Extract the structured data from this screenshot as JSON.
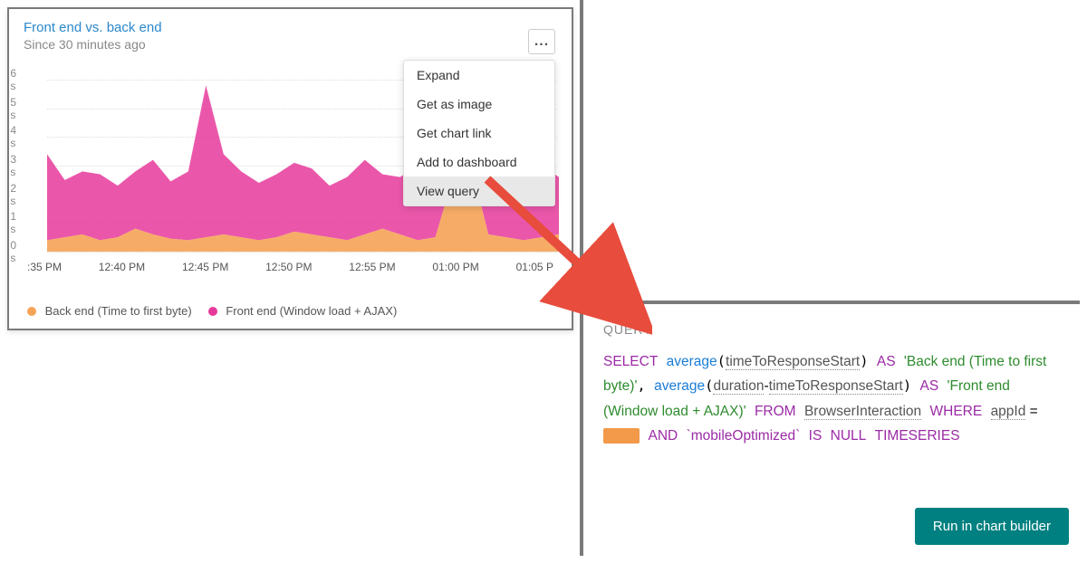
{
  "chart_data": {
    "type": "area",
    "title": "Front end vs. back end",
    "subtitle": "Since 30 minutes ago",
    "ylabel": "seconds",
    "ylim": [
      0,
      6
    ],
    "yticks": [
      "6 s",
      "5 s",
      "4 s",
      "3 s",
      "2 s",
      "1 s",
      "0 s"
    ],
    "xticks": [
      ":35 PM",
      "12:40 PM",
      "12:45 PM",
      "12:50 PM",
      "12:55 PM",
      "01:00 PM",
      "01:05 P"
    ],
    "series": [
      {
        "name": "Back end (Time to first byte)",
        "color": "#f5a356",
        "values": [
          0.4,
          0.5,
          0.6,
          0.4,
          0.5,
          0.8,
          0.6,
          0.45,
          0.4,
          0.5,
          0.6,
          0.5,
          0.4,
          0.5,
          0.7,
          0.6,
          0.5,
          0.4,
          0.6,
          0.8,
          0.6,
          0.4,
          0.5,
          2.6,
          3.1,
          0.6,
          0.5,
          0.4,
          0.5,
          0.6
        ]
      },
      {
        "name": "Front end (Window load + AJAX)",
        "color": "#e6399b",
        "values": [
          3.0,
          2.0,
          2.2,
          2.3,
          1.8,
          2.0,
          2.6,
          2.0,
          2.4,
          5.3,
          2.8,
          2.3,
          2.0,
          2.2,
          2.4,
          2.3,
          1.8,
          2.2,
          2.6,
          1.9,
          2.0,
          2.6,
          2.3,
          2.4,
          2.3,
          2.1,
          2.5,
          2.7,
          2.5,
          2.0
        ]
      }
    ]
  },
  "menu": {
    "items": [
      "Expand",
      "Get as image",
      "Get chart link",
      "Add to dashboard",
      "View query"
    ],
    "active": 4
  },
  "more_button": "...",
  "query": {
    "label": "QUERY",
    "tokens": {
      "select": "SELECT",
      "average1": "average",
      "field1": "timeToResponseStart",
      "as1": "AS",
      "alias1": "'Back end (Time to first byte)'",
      "average2": "average",
      "field2a": "duration",
      "minus": "-",
      "field2b": "timeToResponseStart",
      "as2": "AS",
      "alias2": "'Front end (Window load + AJAX)'",
      "from": "FROM",
      "table": "BrowserInteraction",
      "where": "WHERE",
      "appId": "appId",
      "eq": " = ",
      "redacted": "·······",
      "and": "AND",
      "mobileOpt": "`mobileOptimized`",
      "is": "IS",
      "null": "NULL",
      "timeseries": "TIMESERIES"
    }
  },
  "run_button": "Run in chart builder"
}
